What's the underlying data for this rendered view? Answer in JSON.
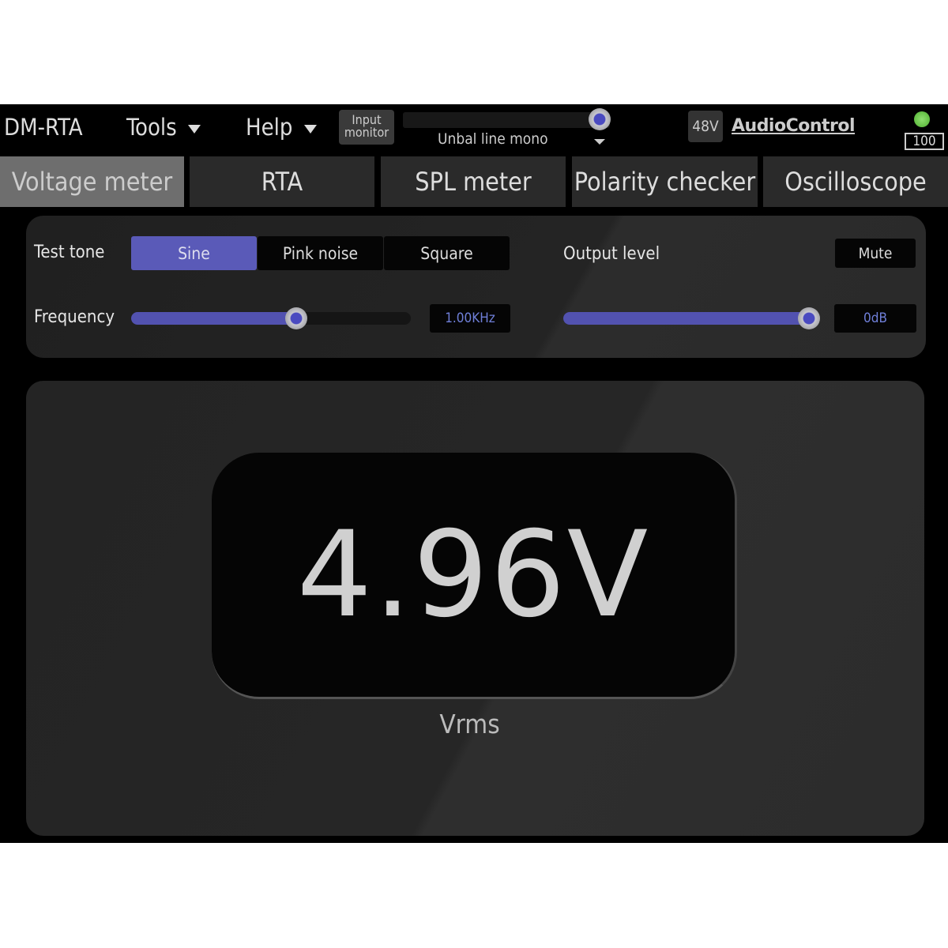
{
  "header": {
    "app_name": "DM-RTA",
    "menus": [
      {
        "label": "Tools"
      },
      {
        "label": "Help"
      }
    ],
    "input_monitor_label": "Input monitor",
    "input_source": "Unbal line mono",
    "input_monitor_level_percent": 95,
    "phantom_power": "48V",
    "brand": "AudioControl",
    "battery": "100",
    "status_led_color": "#5fd040"
  },
  "tabs": [
    {
      "label": "Voltage meter",
      "active": true
    },
    {
      "label": "RTA"
    },
    {
      "label": "SPL meter"
    },
    {
      "label": "Polarity checker"
    },
    {
      "label": "Oscilloscope"
    }
  ],
  "controls": {
    "test_tone_label": "Test tone",
    "tones": [
      "Sine",
      "Pink noise",
      "Square"
    ],
    "selected_tone": "Sine",
    "frequency_label": "Frequency",
    "frequency_value": "1.00KHz",
    "frequency_slider_percent": 59,
    "output_level_label": "Output level",
    "mute_label": "Mute",
    "output_level_value": "0dB",
    "output_slider_percent": 97
  },
  "meter": {
    "reading": "4.96V",
    "unit": "Vrms"
  },
  "colors": {
    "accent": "#5a5ab8",
    "value_text": "#6f7fd8"
  }
}
